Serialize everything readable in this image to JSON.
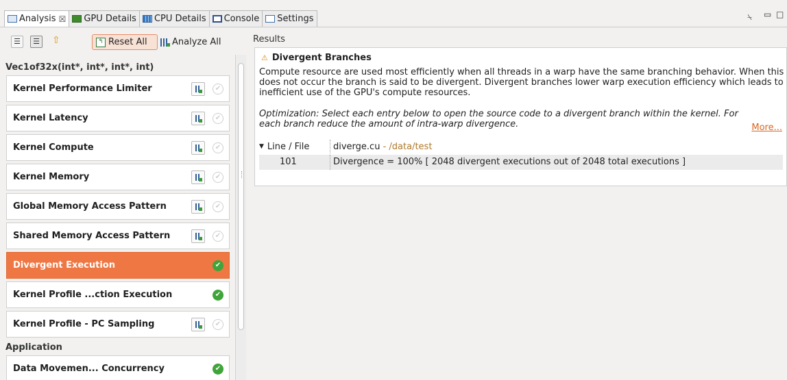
{
  "tabs": [
    {
      "label": "Analysis",
      "icon": "analysis-icon",
      "active": true,
      "close": "☒"
    },
    {
      "label": "GPU Details",
      "icon": "gpu-details-icon"
    },
    {
      "label": "CPU Details",
      "icon": "cpu-details-icon"
    },
    {
      "label": "Console",
      "icon": "console-icon"
    },
    {
      "label": "Settings",
      "icon": "settings-icon"
    }
  ],
  "window_controls": {
    "view_menu": "⍀",
    "minimize": "▭",
    "maximize": "□"
  },
  "toolbar": {
    "reset_all_label": "Reset All",
    "analyze_all_label": "Analyze All"
  },
  "list": {
    "section1": "Vec1of32x(int*, int*, int*, int)",
    "section2": "Application",
    "items": [
      {
        "label": "Kernel Performance Limiter",
        "status": "pending",
        "has_chart": true
      },
      {
        "label": "Kernel Latency",
        "status": "pending",
        "has_chart": true
      },
      {
        "label": "Kernel Compute",
        "status": "pending",
        "has_chart": true
      },
      {
        "label": "Kernel Memory",
        "status": "pending",
        "has_chart": true
      },
      {
        "label": "Global Memory Access Pattern",
        "status": "pending",
        "has_chart": true
      },
      {
        "label": "Shared Memory Access Pattern",
        "status": "pending",
        "has_chart": true
      },
      {
        "label": "Divergent Execution",
        "status": "done",
        "selected": true
      },
      {
        "label": "Kernel Profile ...ction Execution",
        "status": "done"
      },
      {
        "label": "Kernel Profile - PC Sampling",
        "status": "pending",
        "has_chart": true
      },
      {
        "label": "Data Movemen... Concurrency",
        "status": "done"
      }
    ]
  },
  "results": {
    "label": "Results",
    "title": "Divergent Branches",
    "description": "Compute resource are used most efficiently when all threads in a warp have the same branching behavior. When this does not occur the branch is said to be divergent. Divergent branches lower warp execution efficiency which leads to inefficient use of the GPU's compute resources.",
    "optimization": "Optimization: Select each entry below to open the source code to a divergent branch within the kernel. For each branch reduce the amount of intra-warp divergence.",
    "more_link": "More...",
    "table": {
      "header_col1": "Line / File",
      "file": "diverge.cu",
      "path": " - /data/test",
      "rows": [
        {
          "line": "101",
          "text": "Divergence = 100% [ 2048 divergent executions out of 2048 total executions ]"
        }
      ]
    }
  },
  "colors": {
    "selected": "#ee7744",
    "success": "#3fa53a",
    "link": "#d9661f"
  }
}
